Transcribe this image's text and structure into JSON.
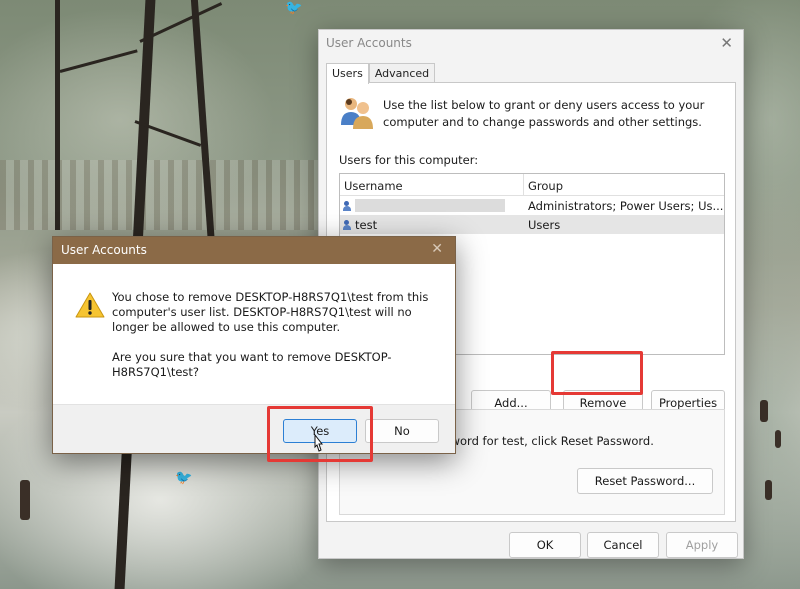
{
  "main_window": {
    "title": "User Accounts",
    "close_glyph": "✕",
    "tabs": [
      {
        "label": "Users",
        "active": true
      },
      {
        "label": "Advanced",
        "active": false
      }
    ],
    "intro_text": "Use the list below to grant or deny users access to your computer and to change passwords and other settings.",
    "users_label": "Users for this computer:",
    "columns": [
      "Username",
      "Group"
    ],
    "rows": [
      {
        "username": "",
        "group": "Administrators; Power Users; Us...",
        "selected": false
      },
      {
        "username": "test",
        "group": "Users",
        "selected": true
      }
    ],
    "buttons": {
      "add": "Add...",
      "remove": "Remove",
      "properties": "Properties",
      "reset_password": "Reset Password...",
      "ok": "OK",
      "cancel": "Cancel",
      "apply": "Apply"
    },
    "password_text": "To change the password for test, click Reset Password."
  },
  "dialog": {
    "title": "User Accounts",
    "close_glyph": "✕",
    "icon": "warning-icon",
    "message_line1": "You chose to remove DESKTOP-H8RS7Q1\\test from this computer's user list. DESKTOP-H8RS7Q1\\test will no longer be allowed to use this computer.",
    "message_line2": "Are you sure that you want to remove DESKTOP-H8RS7Q1\\test?",
    "yes_label": "Yes",
    "no_label": "No"
  },
  "colors": {
    "highlight_red": "#e53935",
    "dialog_titlebar": "#8b6a47",
    "primary_button_border": "#2c7fd4",
    "primary_button_fill": "#dcecfb",
    "warning_yellow": "#f6c431"
  }
}
